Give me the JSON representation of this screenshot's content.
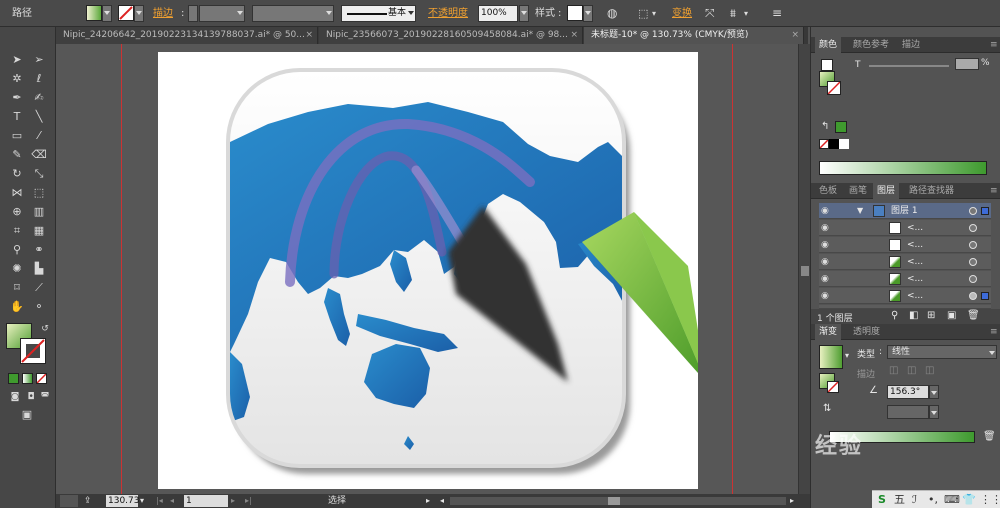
{
  "control_bar": {
    "object_type": "路径",
    "stroke_label": "描边",
    "stroke_style": "基本",
    "opacity_label": "不透明度",
    "opacity_value": "100%",
    "style_label": "样式",
    "transform_label": "变换"
  },
  "tabs": [
    {
      "label": "Nipic_24206642_20190223134139788037.ai* @ 50..."
    },
    {
      "label": "Nipic_23566073_20190228160509458084.ai* @ 98..."
    },
    {
      "label": "未标题-10* @ 130.73% (CMYK/预览)"
    }
  ],
  "status": {
    "zoom": "130.73",
    "artboard": "1",
    "tool_name": "选择"
  },
  "color_panel": {
    "tabs": [
      "颜色",
      "颜色参考",
      "描边"
    ],
    "t_label": "T",
    "accent_green": "#4aa33a"
  },
  "layers_panel": {
    "tabs": [
      "色板",
      "画笔",
      "图层",
      "路径查找器"
    ],
    "rows": [
      {
        "name": "图层 1"
      },
      {
        "name": "<..."
      },
      {
        "name": "<..."
      },
      {
        "name": "<..."
      },
      {
        "name": "<..."
      },
      {
        "name": "<..."
      },
      {
        "name": "<..."
      }
    ],
    "footer": "1 个图层"
  },
  "gradient_panel": {
    "tabs": [
      "渐变",
      "透明度"
    ],
    "type_label": "类型",
    "type_value": "线性",
    "stroke_label": "描边",
    "angle_value": "156.3°",
    "gradient_start": "#ffffff",
    "gradient_end": "#3e9a2e"
  },
  "watermark": "经验",
  "taskbar": {
    "items": [
      "五",
      "ℐ",
      "•,",
      "⌨",
      "👕",
      "⋮⋮"
    ]
  }
}
